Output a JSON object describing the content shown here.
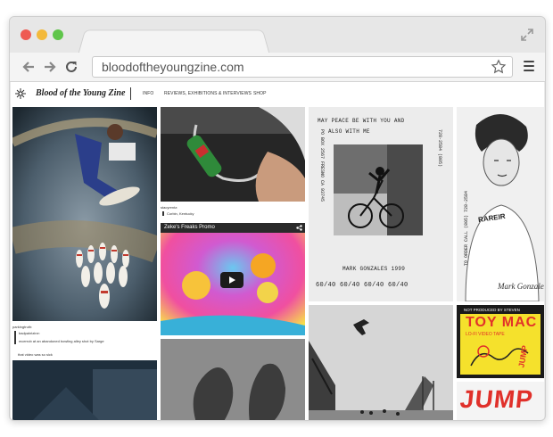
{
  "browser": {
    "url": "bloodoftheyoungzine.com",
    "icons": [
      "back-icon",
      "forward-icon",
      "reload-icon",
      "star-icon",
      "menu-icon",
      "expand-icon"
    ]
  },
  "site": {
    "title": "Blood of the Young Zine",
    "nav": [
      "INFO",
      "REVIEWS, EXHIBITIONS & INTERVIEWS",
      "SHOP"
    ]
  },
  "posts": {
    "bowling": {
      "username": "parkingtruth:",
      "reblog_user": "badpaintzine:",
      "reblog_text": "mcerrob at an abandoned bowling alley shot by Sarge",
      "comment": "that video was so sick"
    },
    "soda": {
      "username": "stacyrentz:",
      "location": "Corbin, Kentucky"
    },
    "video": {
      "title": "Zeke's Freaks Promo"
    },
    "gonzales_zine": {
      "line1": "MAY PEACE BE WITH YOU AND",
      "line2": "ALSO WITH ME",
      "left_vertical": "PO BOX 2567 FRESNO CA 93745",
      "right_vertical": "728-2584 (805)",
      "signature": "MARK GONZALES 1999",
      "prices": "60/40 60/40 60/40 60/40"
    },
    "portrait": {
      "vertical": "TO ORDER CALL (805) 728-2584",
      "shirt": "RAREIR",
      "signature": "Mark Gonzales"
    },
    "toymac": {
      "line1": "NOT PRODUCED BY STEVEN",
      "big": "TOY MAC",
      "line2": "LO-FI VIDEO TAPE",
      "jump": "JUMP"
    }
  }
}
